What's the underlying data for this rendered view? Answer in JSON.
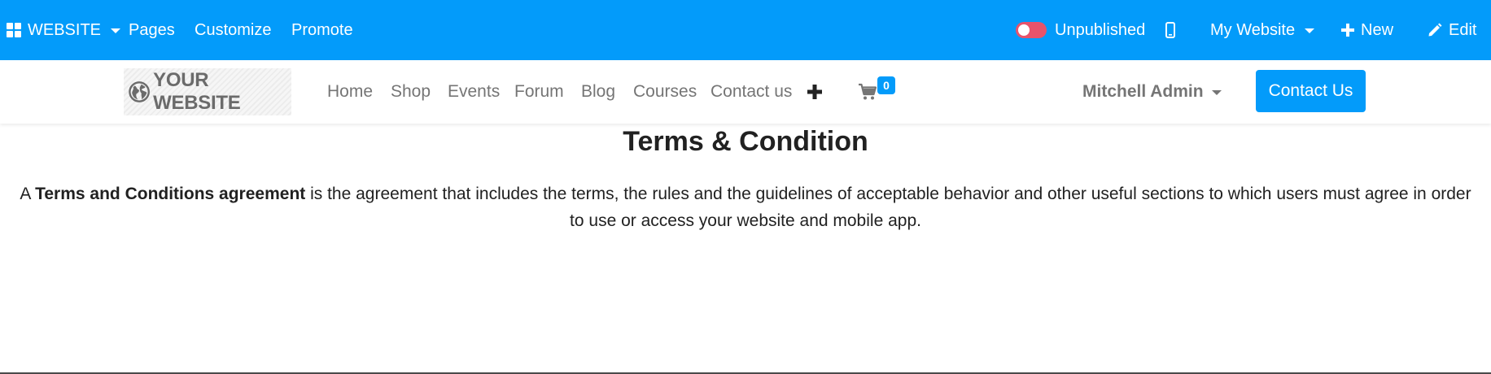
{
  "admin_bar": {
    "app_menu_label": "WEBSITE",
    "pages_label": "Pages",
    "customize_label": "Customize",
    "promote_label": "Promote",
    "publish_status_label": "Unpublished",
    "website_switcher_label": "My Website",
    "new_label": "New",
    "edit_label": "Edit",
    "icons": {
      "app_menu": "apps-grid-icon",
      "mobile_preview": "mobile-phone-icon",
      "new": "plus-icon",
      "edit": "pencil-icon"
    },
    "colors": {
      "background": "#039bfa",
      "toggle_off": "#e8536b"
    }
  },
  "site_nav": {
    "logo_text": "YOUR WEBSITE",
    "logo_icon": "globe-icon",
    "menu": [
      {
        "label": "Home"
      },
      {
        "label": "Shop"
      },
      {
        "label": "Events"
      },
      {
        "label": "Forum"
      },
      {
        "label": "Blog"
      },
      {
        "label": "Courses"
      },
      {
        "label": "Contact us"
      }
    ],
    "add_menu_icon": "plus-icon",
    "cart_icon": "shopping-cart-icon",
    "cart_count": "0",
    "user_name": "Mitchell Admin",
    "cta_label": "Contact Us",
    "colors": {
      "primary": "#039bfa",
      "link": "#757575"
    }
  },
  "page": {
    "title": "Terms & Condition",
    "body_lead": "A ",
    "body_bold": "Terms and Conditions agreement",
    "body_rest": " is the agreement that includes the terms, the rules and the guidelines of acceptable behavior and other useful sections to which users must agree in order to use or access your website and mobile app."
  }
}
